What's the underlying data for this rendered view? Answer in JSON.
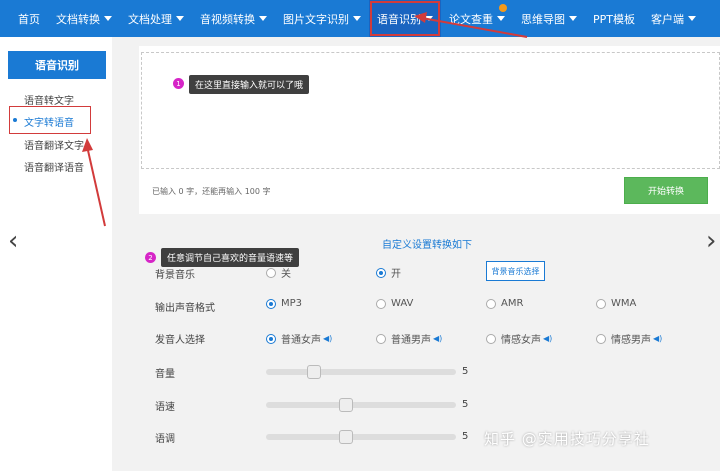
{
  "nav": {
    "items": [
      {
        "label": "首页",
        "caret": false
      },
      {
        "label": "文档转换",
        "caret": true
      },
      {
        "label": "文档处理",
        "caret": true
      },
      {
        "label": "音视频转换",
        "caret": true
      },
      {
        "label": "图片文字识别",
        "caret": true
      },
      {
        "label": "语音识别",
        "caret": true,
        "active": true
      },
      {
        "label": "论文查重",
        "caret": true,
        "badge": true
      },
      {
        "label": "思维导图",
        "caret": true
      },
      {
        "label": "PPT模板",
        "caret": false
      },
      {
        "label": "客户端",
        "caret": true
      }
    ]
  },
  "sidebar": {
    "title": "语音识别",
    "items": [
      {
        "label": "语音转文字"
      },
      {
        "label": "文字转语音",
        "active": true
      },
      {
        "label": "语音翻译文字"
      },
      {
        "label": "语音翻译语音"
      }
    ]
  },
  "input": {
    "counter": "已输入 0 字，还能再输入 100 字",
    "start_label": "开始转换"
  },
  "tips": {
    "tip1": {
      "num": "1",
      "text": "在这里直接输入就可以了哦"
    },
    "tip2": {
      "num": "2",
      "text": "任意调节自己喜欢的音量语速等"
    }
  },
  "settings": {
    "title": "自定义设置转换如下",
    "bgmusic": {
      "label": "背景音乐",
      "off": "关",
      "on": "开",
      "selected": "开",
      "select_button": "背景音乐选择"
    },
    "format": {
      "label": "输出声音格式",
      "options": [
        "MP3",
        "WAV",
        "AMR",
        "WMA"
      ],
      "selected": "MP3"
    },
    "voice": {
      "label": "发音人选择",
      "options": [
        "普通女声",
        "普通男声",
        "情感女声",
        "情感男声"
      ],
      "selected": "普通女声"
    },
    "volume": {
      "label": "音量",
      "value": "5",
      "level": 0.25
    },
    "speed": {
      "label": "语速",
      "value": "5",
      "level": 0.42
    },
    "tone": {
      "label": "语调",
      "value": "5",
      "level": 0.42
    }
  },
  "watermark": "知乎 @实用技巧分享社",
  "colors": {
    "nav_bg": "#1a7ad4",
    "accent": "#1a7ad4",
    "start_button": "#5cb85c",
    "annotation_red": "#d23b3b",
    "tip_badge": "#d625c7"
  },
  "icons": {
    "prev": "chevron-left-icon",
    "next": "chevron-right-icon",
    "voice_preview": "speaker-icon"
  }
}
